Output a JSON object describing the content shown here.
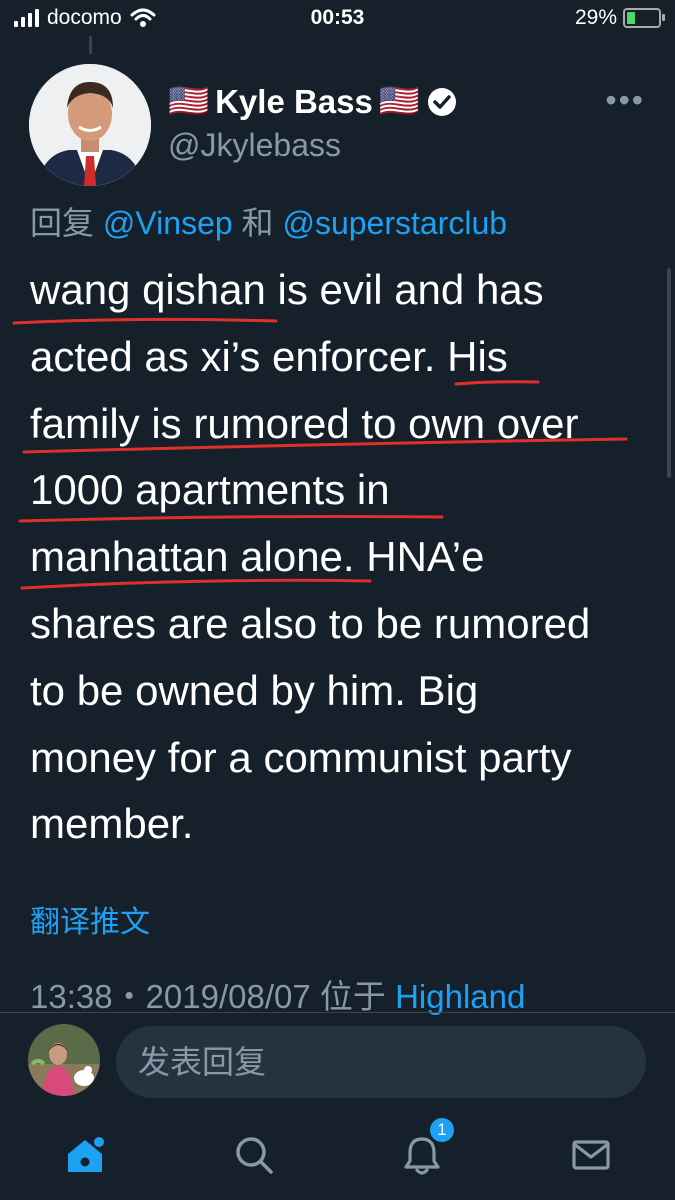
{
  "status_bar": {
    "carrier": "docomo",
    "time": "00:53",
    "battery_percent_text": "29%",
    "battery_level": 0.29
  },
  "tweet": {
    "author_name": "Kyle Bass",
    "author_flag_left": "🇺🇸",
    "author_flag_right": "🇺🇸",
    "handle": "@Jkylebass",
    "verified_icon": "verified-badge-icon",
    "more_label": "•••",
    "reply_prefix": "回复",
    "reply_mention_1": "@Vinsep",
    "reply_conjunction": "和",
    "reply_mention_2": "@superstarclub",
    "body": "wang qishan is evil and has\nacted as xi’s enforcer. His\nfamily is rumored to own over\n1000 apartments in\nmanhattan alone. HNA’e\nshares are also to be rumored\nto be owned by him. Big\nmoney for a communist party\nmember.",
    "translate_label": "翻译推文",
    "timestamp": "13:38・2019/08/07",
    "location_prefix": "位于",
    "location": "Highland"
  },
  "reply_box": {
    "placeholder": "发表回复"
  },
  "tabbar": {
    "items": [
      {
        "name": "home",
        "icon": "home-icon",
        "active": true
      },
      {
        "name": "search",
        "icon": "search-icon",
        "active": false
      },
      {
        "name": "notifications",
        "icon": "bell-icon",
        "active": false,
        "badge": "1"
      },
      {
        "name": "messages",
        "icon": "mail-icon",
        "active": false
      }
    ]
  },
  "colors": {
    "background": "#15202b",
    "accent": "#1da1f2",
    "secondary_text": "#8899a6",
    "annotation": "#e0302a",
    "input_bg": "#253341"
  }
}
